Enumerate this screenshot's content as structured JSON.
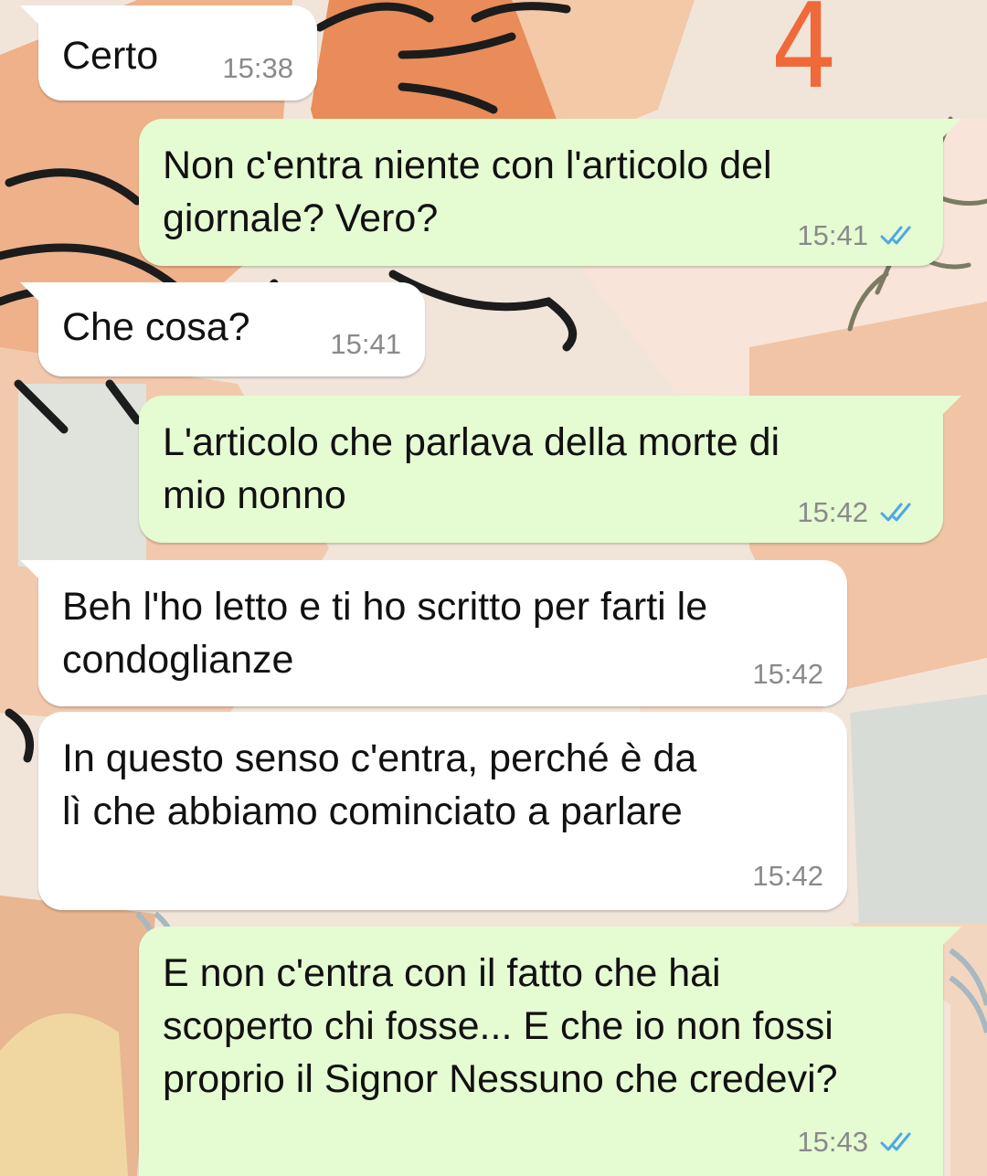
{
  "page_label": "4",
  "colors": {
    "incoming_bubble": "#ffffff",
    "outgoing_bubble": "#e5fbd2",
    "read_ticks": "#4fa8e4",
    "page_label": "#f0693b"
  },
  "messages": [
    {
      "direction": "incoming",
      "text": "Certo",
      "time": "15:38"
    },
    {
      "direction": "outgoing",
      "text": "Non c'entra niente con l'articolo del\ngiornale? Vero?",
      "time": "15:41",
      "status_icon": "double-check-icon"
    },
    {
      "direction": "incoming",
      "text": "Che cosa?",
      "time": "15:41"
    },
    {
      "direction": "outgoing",
      "text": "L'articolo che parlava della morte di\nmio nonno",
      "time": "15:42",
      "status_icon": "double-check-icon"
    },
    {
      "direction": "incoming",
      "text": "Beh l'ho letto e ti ho scritto per farti le\ncondoglianze",
      "time": "15:42"
    },
    {
      "direction": "incoming",
      "text": "In questo senso c'entra, perché è da\nlì che abbiamo cominciato a parlare",
      "time": "15:42"
    },
    {
      "direction": "outgoing",
      "text": "E non c'entra con il fatto che hai\nscoperto chi fosse... E che io non fossi\nproprio il Signor Nessuno che credevi?",
      "time": "15:43",
      "status_icon": "double-check-icon"
    }
  ]
}
